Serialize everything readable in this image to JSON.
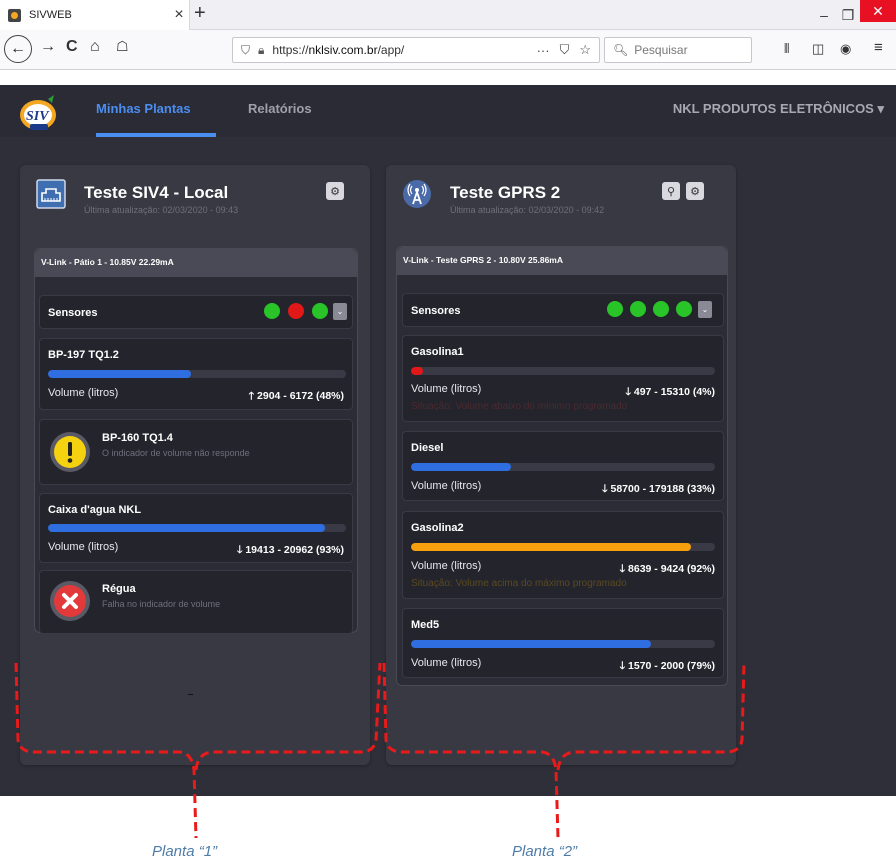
{
  "browser": {
    "tab_title": "SIVWEB",
    "tab_close": "×",
    "new_tab": "+",
    "window_min": "–",
    "window_max": "❐",
    "window_close": "✕",
    "back": "←",
    "forward": "→",
    "reload": "C",
    "home": "⌂",
    "url_prefix": "https://",
    "url_host": "nklsiv.com.br",
    "url_path": "/app/",
    "url_more": "···",
    "search_placeholder": "Pesquisar"
  },
  "app": {
    "nav": {
      "active": "Minhas Plantas",
      "inactive": "Relatórios",
      "company": "NKL PRODUTOS ELETRÔNICOS ▾"
    },
    "plants": [
      {
        "name": "Teste SIV4 - Local",
        "updated": "Última atualização: 02/03/2020 - 09:43",
        "vlink": "V-Link - Pátio 1 - 10.85V 22.29mA",
        "sensors_label": "Sensores",
        "sensor_dots": [
          "#28c428",
          "#e01818",
          "#28c428"
        ],
        "items": [
          {
            "name": "BP-197 TQ1.2",
            "type": "bar",
            "fill": 0.48,
            "color": "#2f6ee0",
            "label": "Volume (litros)",
            "value": "🡑 2904 - 6172 (48%)",
            "status": ""
          },
          {
            "name": "BP-160 TQ1.4",
            "type": "warning",
            "message": "O indicador de volume não responde"
          },
          {
            "name": "Caixa d'agua NKL",
            "type": "bar",
            "fill": 0.93,
            "color": "#2f6ee0",
            "label": "Volume (litros)",
            "value": "🡓 19413 - 20962 (93%)",
            "status": ""
          },
          {
            "name": "Régua",
            "type": "error",
            "message": "Falha no indicador de volume"
          }
        ]
      },
      {
        "name": "Teste GPRS 2",
        "updated": "Última atualização: 02/03/2020 - 09:42",
        "vlink": "V-Link - Teste GPRS 2 - 10.80V 25.86mA",
        "sensors_label": "Sensores",
        "sensor_dots": [
          "#28c428",
          "#28c428",
          "#28c428",
          "#28c428"
        ],
        "items": [
          {
            "name": "Gasolina1",
            "type": "bar",
            "fill": 0.04,
            "color": "#e01818",
            "label": "Volume (litros)",
            "value": "🡓 497 - 15310 (4%)",
            "status": "Situação: Volume abaixo do mínimo programado"
          },
          {
            "name": "Diesel",
            "type": "bar",
            "fill": 0.33,
            "color": "#2f6ee0",
            "label": "Volume (litros)",
            "value": "🡓 58700 - 179188 (33%)",
            "status": ""
          },
          {
            "name": "Gasolina2",
            "type": "bar",
            "fill": 0.92,
            "color": "#f5a00c",
            "label": "Volume (litros)",
            "value": "🡓 8639 - 9424 (92%)",
            "status": "Situação: Volume acima do máximo programado"
          },
          {
            "name": "Med5",
            "type": "bar",
            "fill": 0.79,
            "color": "#2f6ee0",
            "label": "Volume (litros)",
            "value": "🡓 1570 - 2000 (79%)",
            "status": ""
          }
        ]
      }
    ]
  },
  "annotations": {
    "plant1": "Planta “1”",
    "plant2": "Planta “2”",
    "color": "#e81a1a"
  }
}
